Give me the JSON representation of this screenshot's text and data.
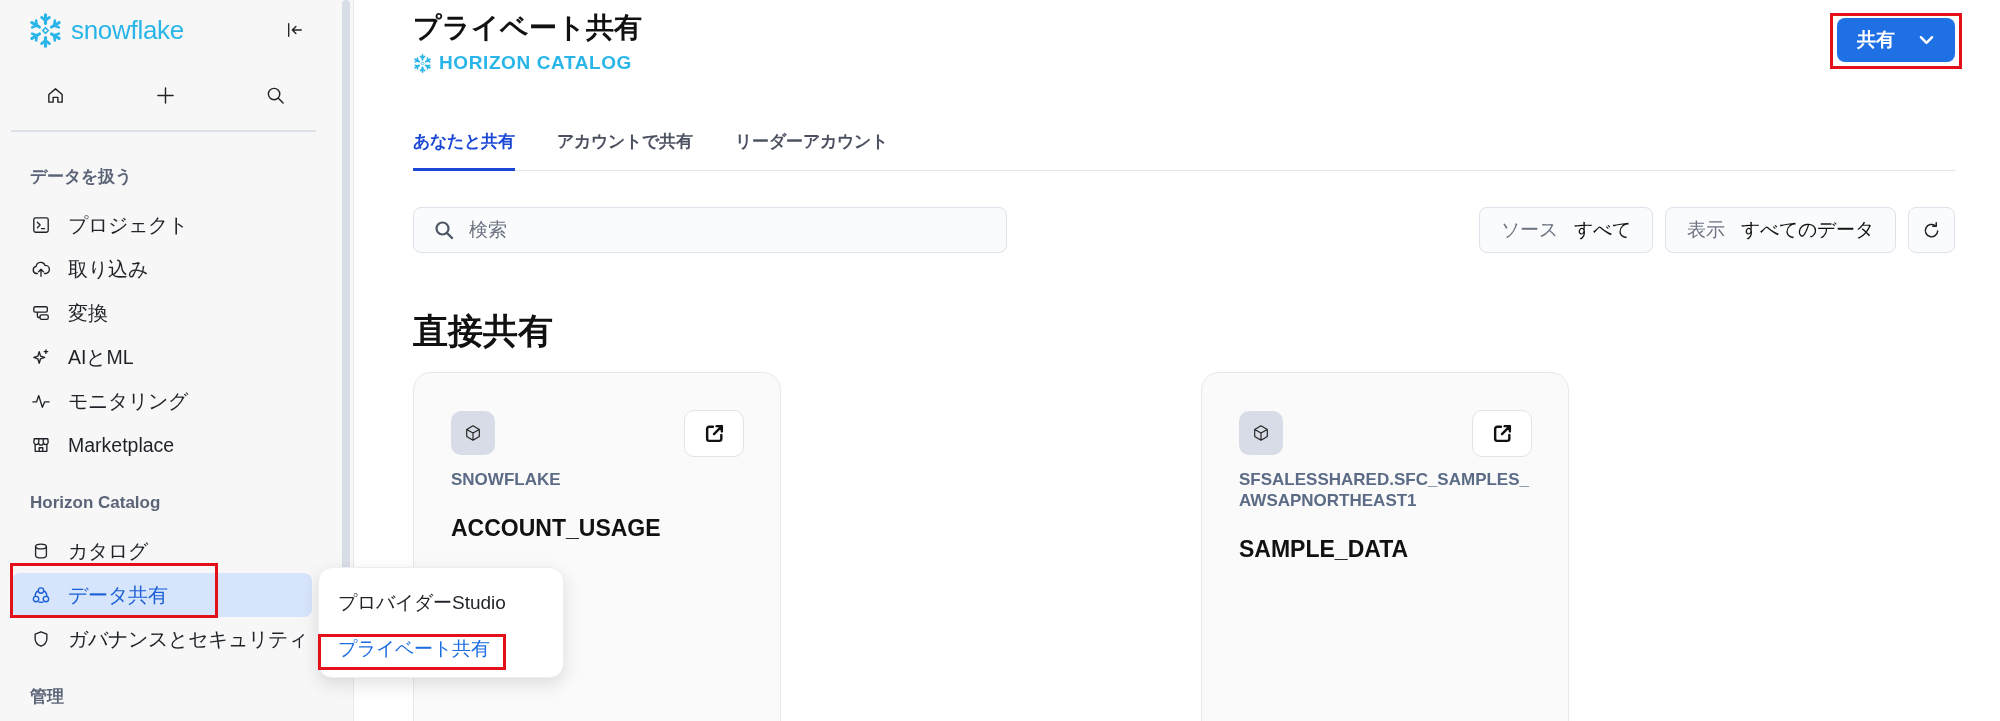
{
  "sidebar": {
    "logo": "snowflake",
    "sections": [
      {
        "title": "データを扱う",
        "items": [
          {
            "label": "プロジェクト",
            "selected": false,
            "annotated": false
          },
          {
            "label": "取り込み",
            "selected": false,
            "annotated": false
          },
          {
            "label": "変換",
            "selected": false,
            "annotated": false
          },
          {
            "label": "AIとML",
            "selected": false,
            "annotated": false
          },
          {
            "label": "モニタリング",
            "selected": false,
            "annotated": false
          },
          {
            "label": "Marketplace",
            "selected": false,
            "annotated": false
          }
        ]
      },
      {
        "title": "Horizon Catalog",
        "items": [
          {
            "label": "カタログ",
            "selected": false,
            "annotated": false
          },
          {
            "label": "データ共有",
            "selected": true,
            "annotated": true
          },
          {
            "label": "ガバナンスとセキュリティ",
            "selected": false,
            "annotated": false
          }
        ]
      },
      {
        "title": "管理"
      }
    ]
  },
  "flyout_menu": {
    "items": [
      {
        "label": "プロバイダーStudio",
        "selected": false,
        "annotated": false
      },
      {
        "label": "プライベート共有",
        "selected": true,
        "annotated": true
      }
    ]
  },
  "header": {
    "title": "プライベート共有",
    "catalog_label": "HORIZON CATALOG",
    "share_button": {
      "label": "共有",
      "annotated": true
    }
  },
  "tabs": [
    {
      "label": "あなたと共有",
      "selected": true
    },
    {
      "label": "アカウントで共有",
      "selected": false
    },
    {
      "label": "リーダーアカウント",
      "selected": false
    }
  ],
  "search": {
    "placeholder": "検索"
  },
  "filters": [
    {
      "label": "ソース",
      "value": "すべて"
    },
    {
      "label": "表示",
      "value": "すべてのデータ"
    }
  ],
  "section_heading": "直接共有",
  "cards": [
    {
      "provider": "SNOWFLAKE",
      "name": "ACCOUNT_USAGE"
    },
    {
      "provider": "SFSALESSHARED.SFC_SAMPLES_AWSAPNORTHEAST1",
      "name": "SAMPLE_DATA"
    }
  ]
}
